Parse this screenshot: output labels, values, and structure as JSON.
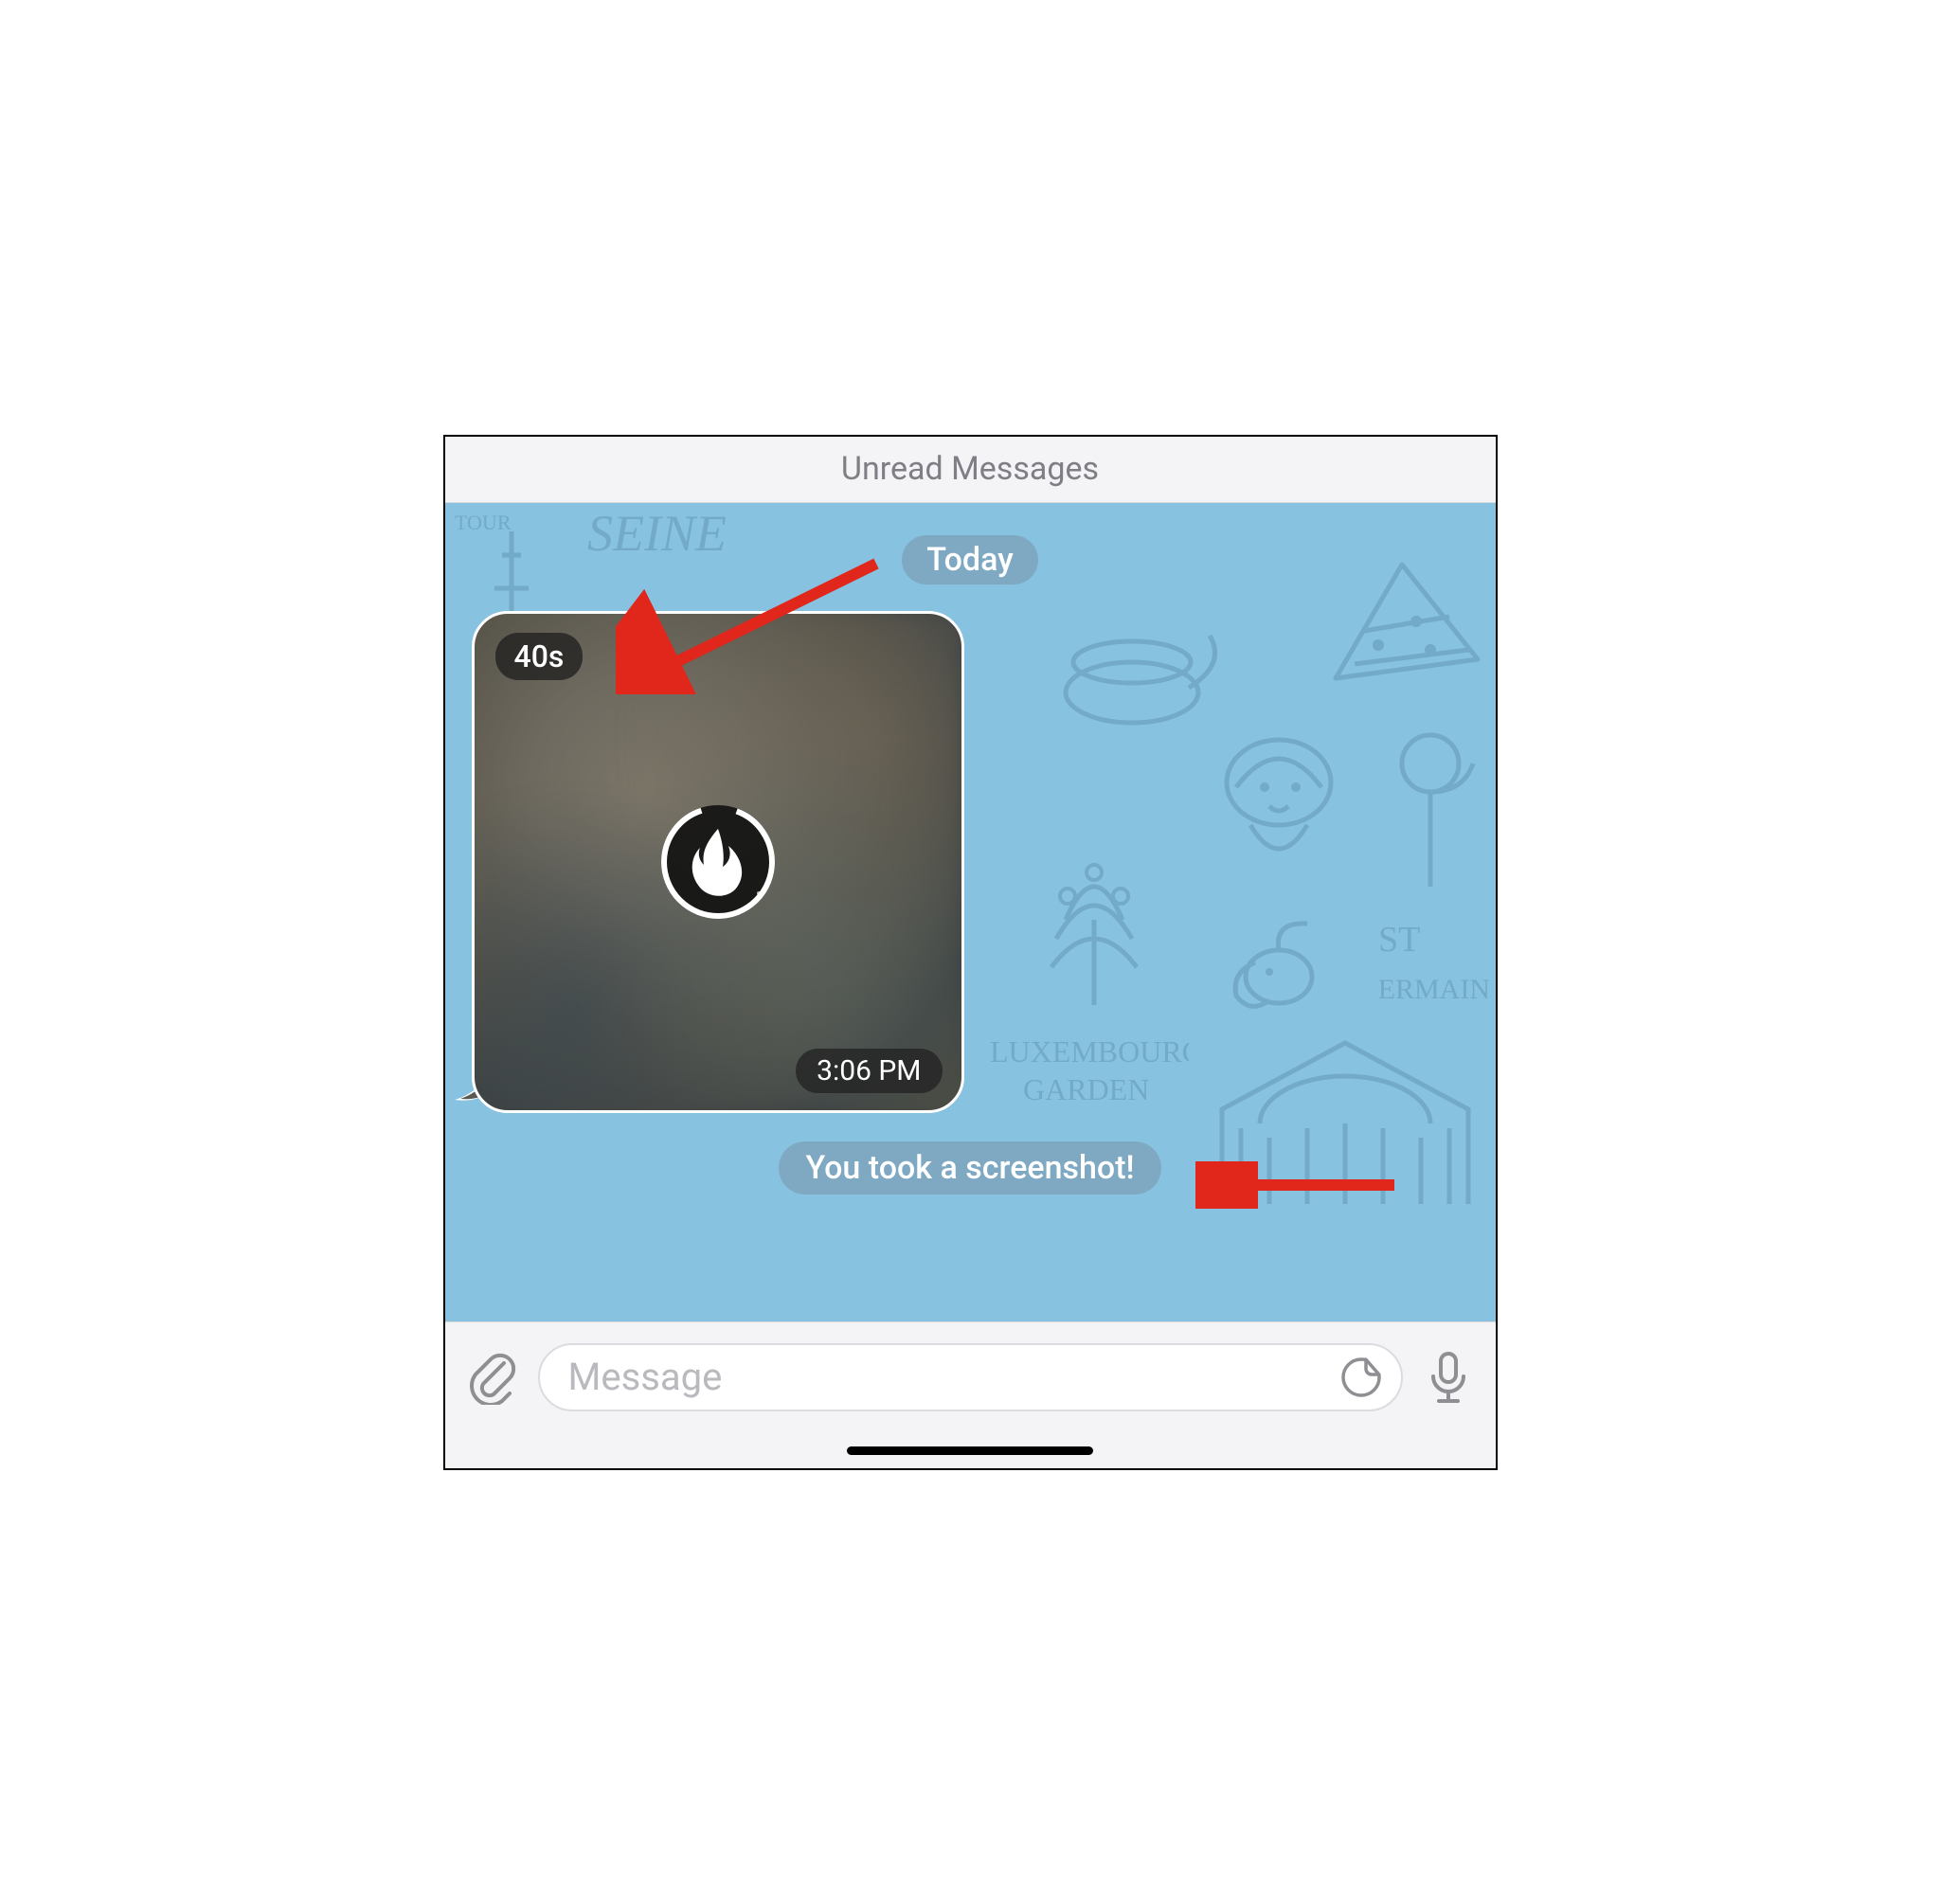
{
  "header": {
    "title": "Unread Messages"
  },
  "chat": {
    "date_label": "Today",
    "message": {
      "duration_label": "40s",
      "time_label": "3:06 PM",
      "media_icon": "flame-icon"
    },
    "system_notice": "You took a screenshot!"
  },
  "composer": {
    "placeholder": "Message",
    "attach_icon": "paperclip-icon",
    "sticker_icon": "sticker-icon",
    "mic_icon": "microphone-icon"
  },
  "annotations": {
    "arrow1_target": "duration-badge",
    "arrow2_target": "system-notice"
  }
}
